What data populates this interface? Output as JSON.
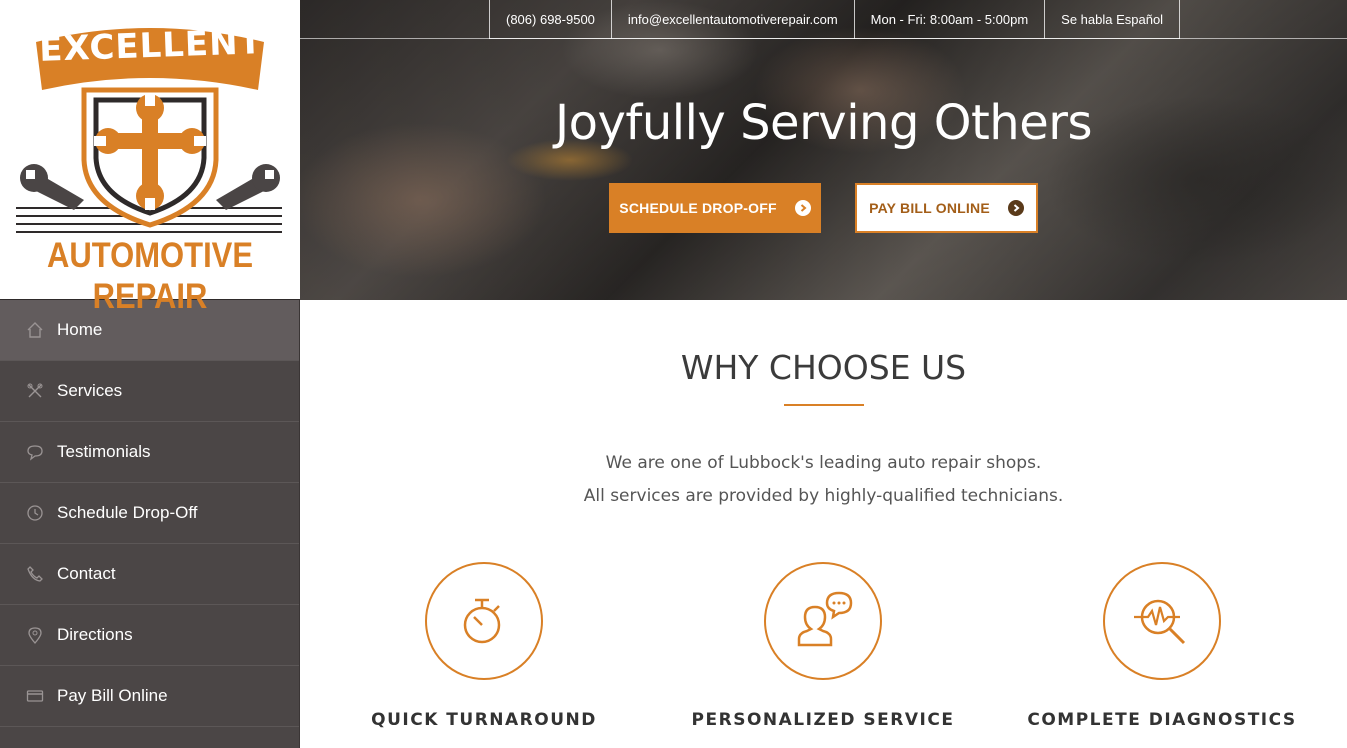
{
  "logo": {
    "top_text": "EXCELLENT",
    "bottom_text": "AUTOMOTIVE REPAIR",
    "brand_color": "#d98026"
  },
  "sidebar": {
    "items": [
      {
        "label": "Home",
        "icon": "home-icon",
        "active": true
      },
      {
        "label": "Services",
        "icon": "tools-icon"
      },
      {
        "label": "Testimonials",
        "icon": "speech-bubble-icon"
      },
      {
        "label": "Schedule Drop-Off",
        "icon": "clock-icon"
      },
      {
        "label": "Contact",
        "icon": "phone-icon"
      },
      {
        "label": "Directions",
        "icon": "map-pin-icon"
      },
      {
        "label": "Pay Bill Online",
        "icon": "credit-card-icon"
      }
    ]
  },
  "topbar": {
    "phone": "(806) 698-9500",
    "email": "info@excellentautomotiverepair.com",
    "hours": "Mon - Fri: 8:00am - 5:00pm",
    "language": "Se habla Español"
  },
  "hero": {
    "title": "Joyfully Serving Others",
    "primary_button": "SCHEDULE DROP-OFF",
    "secondary_button": "PAY BILL ONLINE"
  },
  "why": {
    "title": "WHY CHOOSE US",
    "line1": "We are one of Lubbock's leading auto repair shops.",
    "line2": "All services are provided by highly-qualified technicians.",
    "features": [
      {
        "title": "QUICK TURNAROUND",
        "icon": "stopwatch-icon"
      },
      {
        "title": "PERSONALIZED SERVICE",
        "icon": "person-chat-icon"
      },
      {
        "title": "COMPLETE DIAGNOSTICS",
        "icon": "diagnostic-magnifier-icon"
      }
    ]
  },
  "colors": {
    "accent": "#d98026",
    "sidebar_bg": "#4b4646",
    "sidebar_active": "#625c5d"
  }
}
